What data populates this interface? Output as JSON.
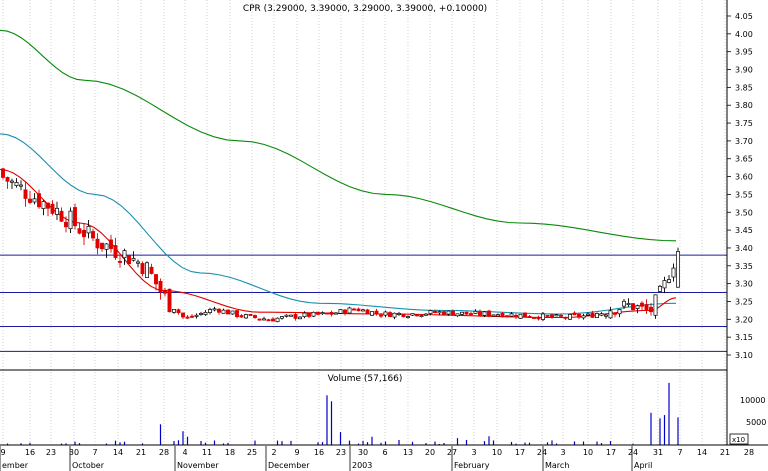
{
  "chart_data": [
    {
      "type": "candlestick",
      "title": "CPR (3.29000, 3.39000, 3.29000, 3.39000, +0.10000)",
      "ylim": [
        3.07,
        4.07
      ],
      "y_ticks": [
        "4.05",
        "4.00",
        "3.95",
        "3.90",
        "3.85",
        "3.80",
        "3.75",
        "3.70",
        "3.65",
        "3.60",
        "3.55",
        "3.50",
        "3.45",
        "3.40",
        "3.35",
        "3.30",
        "3.25",
        "3.20",
        "3.15",
        "3.10"
      ],
      "horizontal_lines": [
        3.38,
        3.275,
        3.18,
        3.11
      ],
      "up_color": "#000000",
      "down_color": "#e00000",
      "grid": "vertical dotted",
      "series": [
        {
          "type": "line",
          "color": "#0a8a0a",
          "values": [
            4.01,
            3.87,
            3.7,
            3.55,
            3.47,
            3.42
          ],
          "x": [
            0,
            84,
            240,
            386,
            520,
            676
          ]
        },
        {
          "type": "line",
          "color": "#1a8fb0",
          "values": [
            3.72,
            3.55,
            3.33,
            3.245,
            3.225,
            3.215,
            3.245
          ],
          "x": [
            0,
            95,
            200,
            320,
            440,
            560,
            676
          ]
        },
        {
          "type": "line",
          "color": "#e00000",
          "values": [
            3.62,
            3.47,
            3.28,
            3.22,
            3.215,
            3.205,
            3.225,
            3.26
          ],
          "x": [
            0,
            80,
            165,
            260,
            380,
            560,
            650,
            676
          ]
        }
      ]
    },
    {
      "type": "bar",
      "title": "Volume (57,166)",
      "y_ticks": [
        "10000",
        "5000"
      ],
      "y_unit": "x10",
      "ylim": [
        0,
        14000
      ],
      "color": "#0000cc"
    }
  ],
  "x_axis": {
    "day_ticks": [
      "9",
      "16",
      "23",
      "30",
      "7",
      "14",
      "21",
      "28",
      "4",
      "11",
      "18",
      "25",
      "2",
      "9",
      "16",
      "23",
      "30",
      "6",
      "13",
      "20",
      "27",
      "3",
      "10",
      "17",
      "24",
      "3",
      "10",
      "17",
      "24",
      "31",
      "7",
      "14",
      "21",
      "28"
    ],
    "month_labels": [
      "ember",
      "October",
      "November",
      "December",
      "2003",
      "February",
      "March",
      "April"
    ]
  }
}
